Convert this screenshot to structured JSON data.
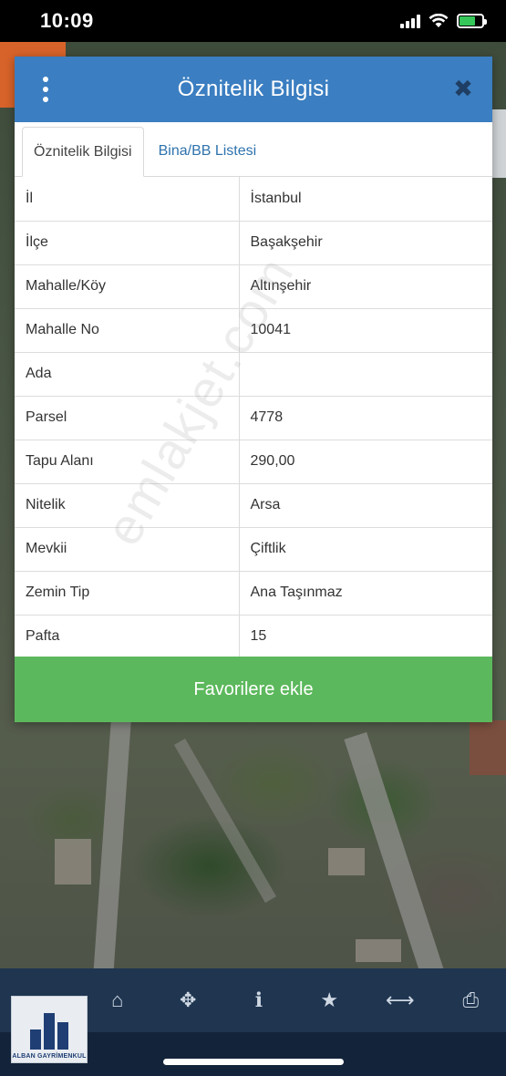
{
  "status_bar": {
    "time": "10:09"
  },
  "dialog": {
    "title": "Öznitelik Bilgisi",
    "close_glyph": "✖",
    "tabs": [
      {
        "label": "Öznitelik Bilgisi",
        "active": true
      },
      {
        "label": "Bina/BB Listesi",
        "active": false
      }
    ],
    "rows": [
      {
        "key": "İl",
        "value": "İstanbul"
      },
      {
        "key": "İlçe",
        "value": "Başakşehir"
      },
      {
        "key": "Mahalle/Köy",
        "value": "Altınşehir"
      },
      {
        "key": "Mahalle No",
        "value": "10041"
      },
      {
        "key": "Ada",
        "value": ""
      },
      {
        "key": "Parsel",
        "value": "4778"
      },
      {
        "key": "Tapu Alanı",
        "value": "290,00"
      },
      {
        "key": "Nitelik",
        "value": "Arsa"
      },
      {
        "key": "Mevkii",
        "value": "Çiftlik"
      },
      {
        "key": "Zemin Tip",
        "value": "Ana Taşınmaz"
      },
      {
        "key": "Pafta",
        "value": "15"
      }
    ],
    "favorite_button": "Favorilere ekle"
  },
  "watermark": "emlakjet.com",
  "toolbar": {
    "icons": [
      "home-icon",
      "crosshair-icon",
      "info-icon",
      "star-icon",
      "measure-icon",
      "print-icon"
    ],
    "glyphs": [
      "⌂",
      "✥",
      "ℹ",
      "★",
      "⟷",
      "⎙"
    ]
  },
  "logo": {
    "text": "ALBAN GAYRİMENKUL"
  },
  "colors": {
    "header_blue": "#3b7ec1",
    "tab_link_blue": "#2e73ae",
    "favorite_green": "#5cb85c",
    "toolbar_navy": "#1f3550",
    "orange_accent": "#d8632a"
  }
}
